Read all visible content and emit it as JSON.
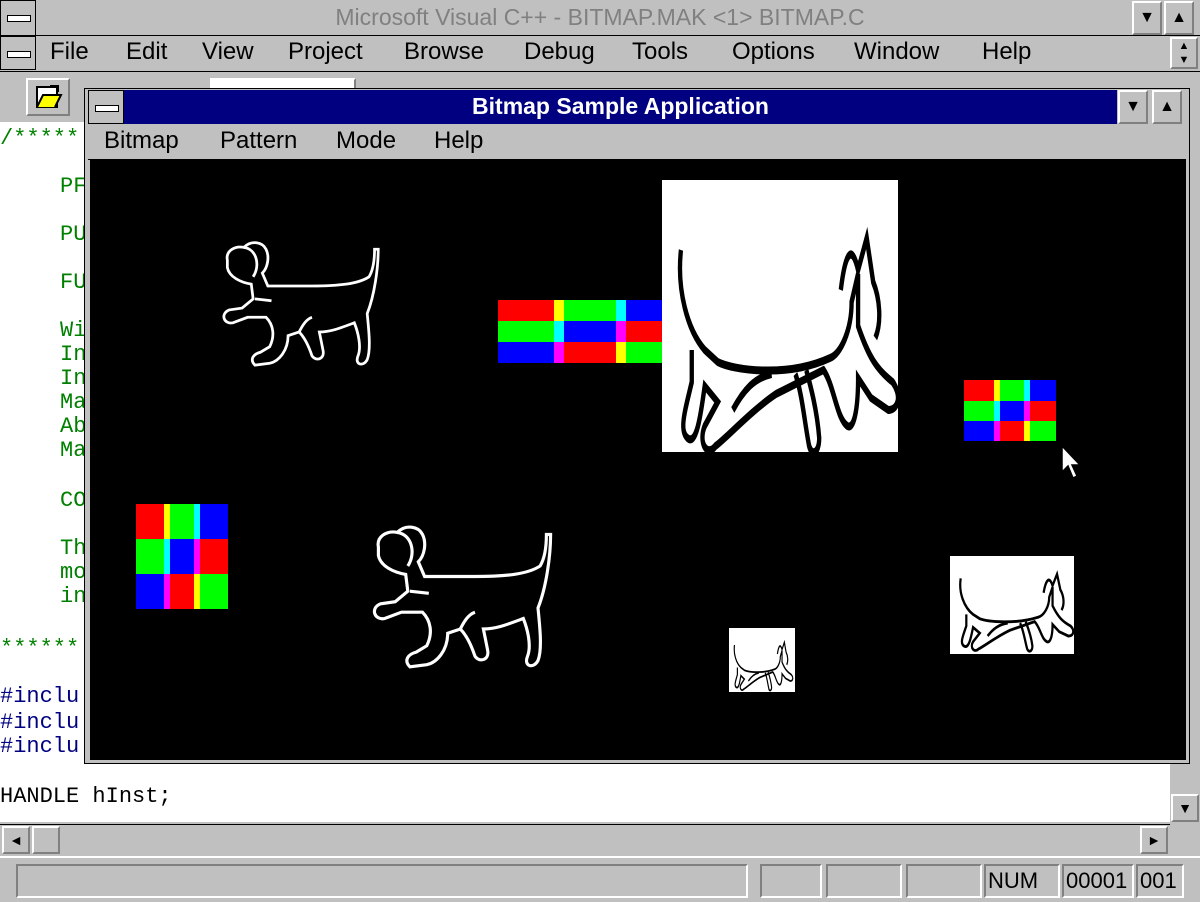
{
  "app": {
    "title": "Microsoft Visual C++ - BITMAP.MAK <1> BITMAP.C"
  },
  "menu": {
    "items": [
      {
        "label": "File"
      },
      {
        "label": "Edit"
      },
      {
        "label": "View"
      },
      {
        "label": "Project"
      },
      {
        "label": "Browse"
      },
      {
        "label": "Debug"
      },
      {
        "label": "Tools"
      },
      {
        "label": "Options"
      },
      {
        "label": "Window"
      },
      {
        "label": "Help"
      }
    ]
  },
  "editor": {
    "lines": [
      {
        "text": "/*****",
        "color": "#008000"
      },
      {
        "text": "PF",
        "color": "#008000"
      },
      {
        "text": "PU",
        "color": "#008000"
      },
      {
        "text": "FU",
        "color": "#008000"
      },
      {
        "text": "Wi",
        "color": "#008000"
      },
      {
        "text": "In",
        "color": "#008000"
      },
      {
        "text": "In",
        "color": "#008000"
      },
      {
        "text": "Ma",
        "color": "#008000"
      },
      {
        "text": "Ab",
        "color": "#008000"
      },
      {
        "text": "Ma",
        "color": "#008000"
      },
      {
        "text": "CO",
        "color": "#008000"
      },
      {
        "text": "Th",
        "color": "#008000"
      },
      {
        "text": "mo",
        "color": "#008000"
      },
      {
        "text": "in",
        "color": "#008000"
      },
      {
        "text": "******",
        "color": "#008000"
      },
      {
        "text": "#inclu",
        "color": "#000080"
      },
      {
        "text": "#inclu",
        "color": "#000080"
      },
      {
        "text": "#inclu",
        "color": "#000080"
      },
      {
        "text": "HANDLE hInst;",
        "color": "#000000"
      }
    ]
  },
  "child_window": {
    "title": "Bitmap Sample Application",
    "menu": [
      {
        "label": "Bitmap"
      },
      {
        "label": "Pattern"
      },
      {
        "label": "Mode"
      },
      {
        "label": "Help"
      }
    ]
  },
  "status_bar": {
    "num": "NUM",
    "line": "00001",
    "col": "001"
  },
  "colors": {
    "title_active": "#000080",
    "window_face": "#c0c0c0",
    "canvas": "#000000",
    "pattern_red": "#ff0000",
    "pattern_green": "#00ff00",
    "pattern_blue": "#0000ff",
    "pattern_yellow": "#ffff00",
    "pattern_magenta": "#ff00ff",
    "pattern_cyan": "#00ffff"
  },
  "icons": [
    "system-menu-icon",
    "minimize-icon",
    "maximize-icon",
    "open-file-icon",
    "scroll-left-icon",
    "scroll-right-icon",
    "scroll-up-icon",
    "scroll-down-icon",
    "mouse-pointer-icon"
  ]
}
